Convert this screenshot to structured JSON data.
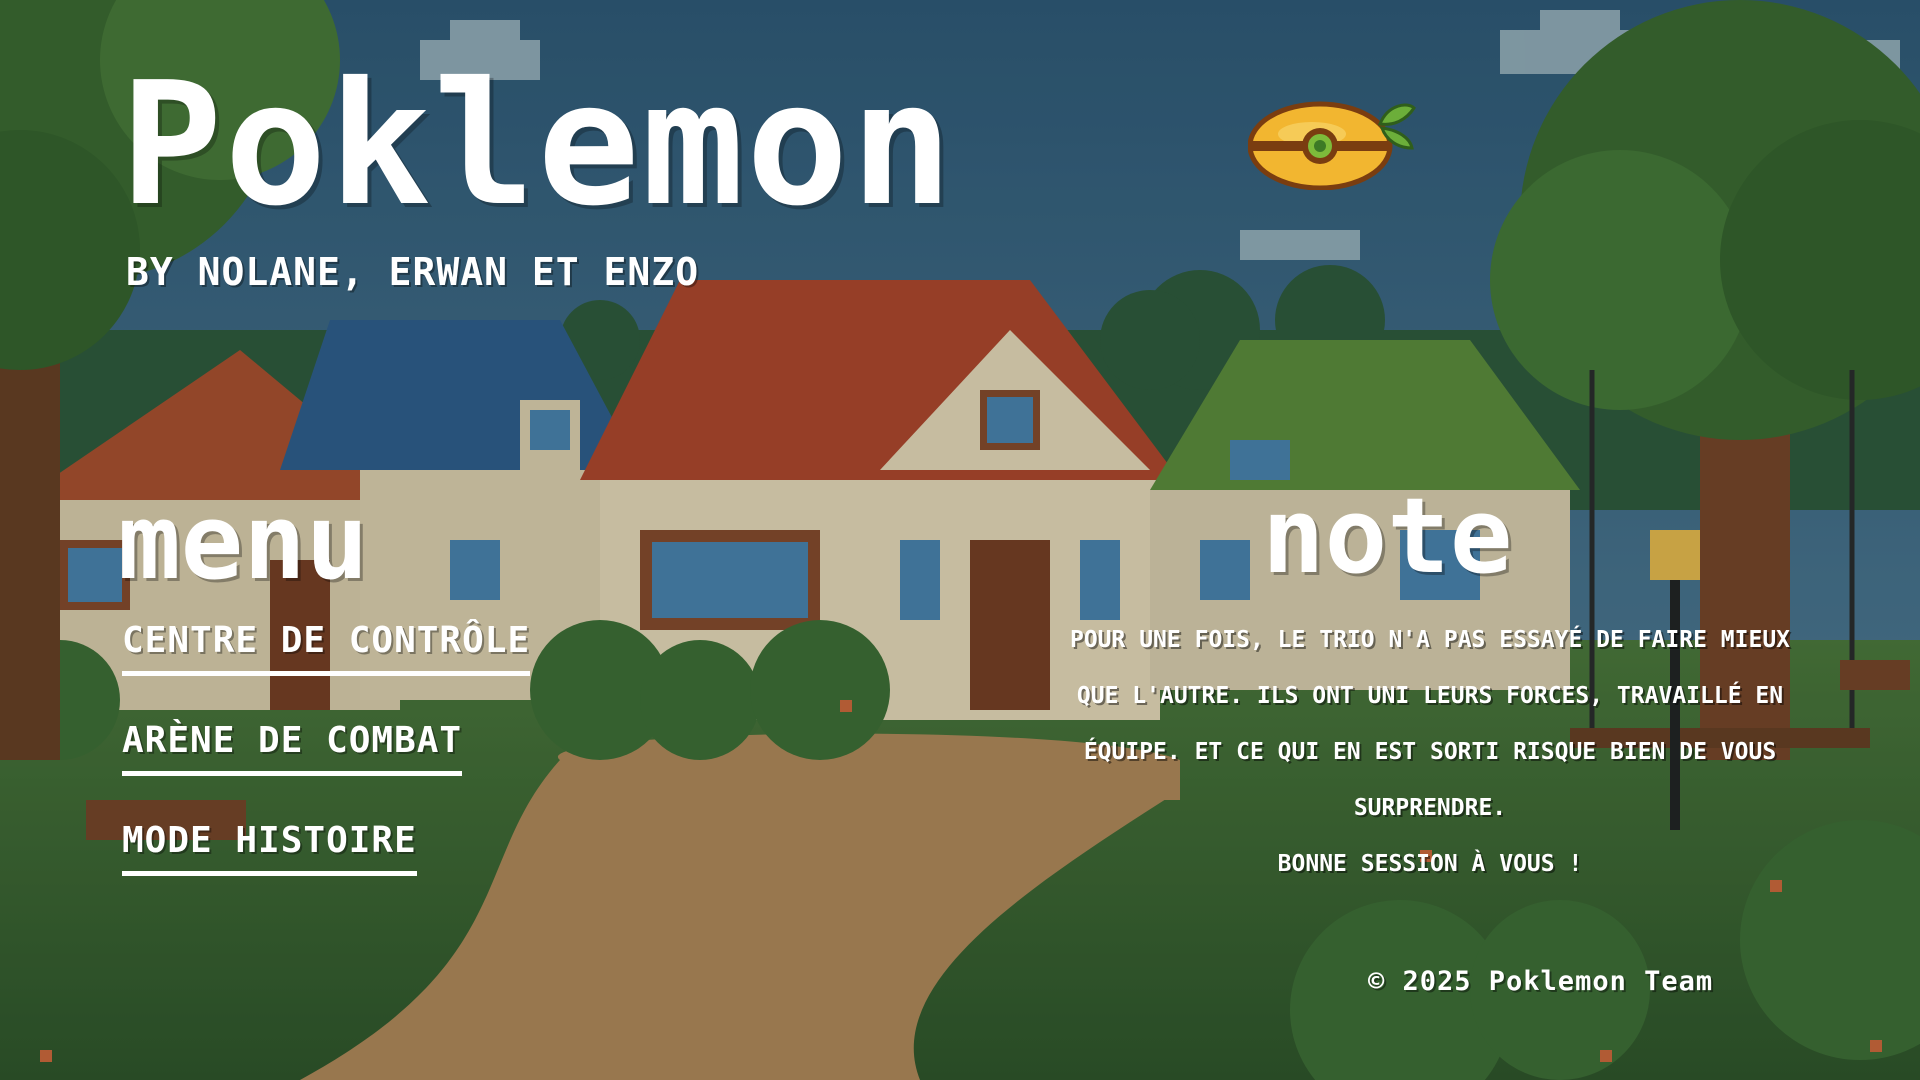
{
  "header": {
    "title": "Poklemon",
    "subtitle": "by Nolane, Erwan et Enzo",
    "logo_icon": "lemon-pokeball-icon"
  },
  "menu": {
    "title": "menu",
    "items": [
      {
        "label": "centre de contrôle"
      },
      {
        "label": "arène de combat"
      },
      {
        "label": "mode histoire"
      }
    ]
  },
  "note": {
    "title": "note",
    "paragraph": "pour une fois, le trio n'a pas essayé de faire mieux que l'autre. ils ont uni leurs forces, travaillé en équipe. et ce qui en est sorti risque bien de vous surprendre.",
    "closing": "bonne session à vous !"
  },
  "footer": {
    "copyright": "© 2025 Poklemon Team"
  },
  "colors": {
    "text": "#ffffff",
    "sky": "#3f6f8e",
    "lemon": "#f2b630"
  }
}
